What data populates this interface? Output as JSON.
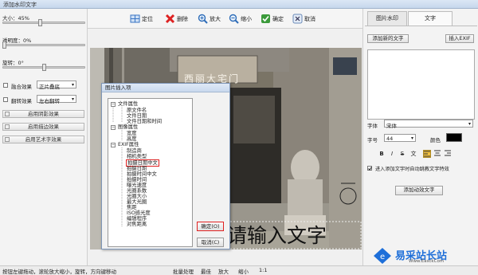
{
  "window": {
    "title": "添加水印文字"
  },
  "left": {
    "size_label": "大小：45%",
    "size_value": 45,
    "opacity_label": "透明度：0%",
    "opacity_value": 0,
    "rotate_label": "旋转：0°",
    "rotate_value": 0,
    "blend_label": "融合效果",
    "blend_select": "正片叠底",
    "flip_label": "翻转效果",
    "flip_select": "左右翻转",
    "shadow_btn": "启用阴影效果",
    "stroke_btn": "启用描边效果",
    "art_btn": "启用艺术字效果"
  },
  "toolbar": {
    "locate": "定位",
    "delete": "删除",
    "zoom_in": "放大",
    "zoom_out": "缩小",
    "confirm": "确定",
    "cancel": "取消"
  },
  "canvas": {
    "plaque": "西丽大宅门",
    "placeholder_text": "请输入文字"
  },
  "dialog": {
    "title": "图片插入项",
    "tree": {
      "file_group": "文件属性",
      "file_items": [
        "原文件名",
        "文件日期",
        "文件日期和时间"
      ],
      "image_group": "图像属性",
      "image_items": [
        "宽度",
        "高度"
      ],
      "exif_group": "EXIF属性",
      "exif_items": [
        "制造商",
        "相机类型",
        "拍摄日期中文",
        "拍摄日期",
        "拍摄时间中文",
        "拍摄时间",
        "曝光速度",
        "光圈系数",
        "光圈大小",
        "最大光圈",
        "焦距",
        "ISO感光度",
        "编辑程序",
        "对焦距离"
      ]
    },
    "ok": "确定(O)",
    "cancel": "取消(C)"
  },
  "right": {
    "tab_image_watermark": "图片水印",
    "tab_text": "文字",
    "add_text_btn": "添加新的文字",
    "insert_exif_btn": "插入EXIF",
    "font_label": "字体",
    "font_value": "宋体",
    "size_label": "字号",
    "size_value": "44",
    "color_label": "颜色",
    "color_value": "#000000",
    "format_buttons": [
      "B",
      "I",
      "S",
      "文"
    ],
    "auto_wrap_label": "进入添加文字时自动跳教文字特效",
    "add_effect_btn": "添加动效文字"
  },
  "status": {
    "hint": "按钮左键拖动，滚轮放大缩小，旋转，方向键移动",
    "batch": "批量处理",
    "best": "最佳",
    "zoom_in": "放大",
    "zoom_out": "缩小",
    "ratio": "1:1"
  },
  "logo": {
    "name": "易采站长站",
    "url": "Www.EasckCom"
  },
  "colors": {
    "accent": "#3a75c4",
    "selection": "#e02020",
    "logo_blue": "#1e6fd9"
  }
}
